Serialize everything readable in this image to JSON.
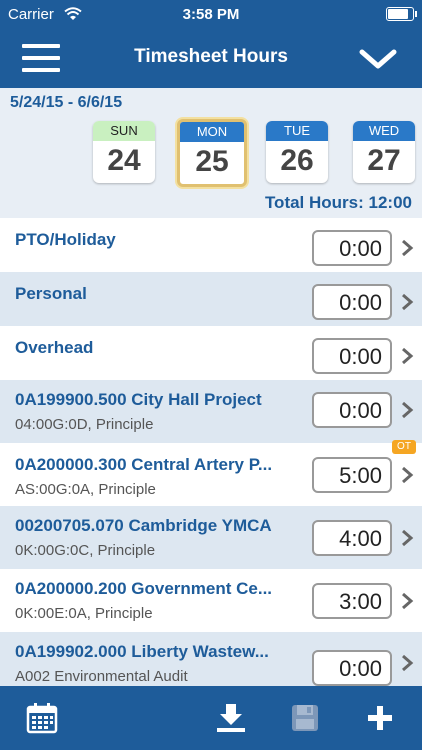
{
  "status_bar": {
    "carrier": "Carrier",
    "time": "3:58 PM",
    "battery_level": 0.9
  },
  "nav": {
    "title": "Timesheet Hours"
  },
  "week": {
    "range": "5/24/15 - 6/6/15",
    "days": [
      {
        "name": "SUN",
        "num": "24"
      },
      {
        "name": "MON",
        "num": "25"
      },
      {
        "name": "TUE",
        "num": "26"
      },
      {
        "name": "WED",
        "num": "27"
      }
    ],
    "selected_day": "MON",
    "total": "Total Hours: 12:00"
  },
  "rows": [
    {
      "label": "PTO/Holiday",
      "sub": "",
      "hours": "0:00",
      "badge": ""
    },
    {
      "label": "Personal",
      "sub": "",
      "hours": "0:00",
      "badge": ""
    },
    {
      "label": "Overhead",
      "sub": "",
      "hours": "0:00",
      "badge": ""
    },
    {
      "label": "0A199900.500 City Hall Project",
      "sub": "04:00G:0D, Principle",
      "hours": "0:00",
      "badge": ""
    },
    {
      "label": "0A200000.300 Central Artery P...",
      "sub": "AS:00G:0A, Principle",
      "hours": "5:00",
      "badge": "OT"
    },
    {
      "label": "00200705.070 Cambridge YMCA",
      "sub": "0K:00G:0C, Principle",
      "hours": "4:00",
      "badge": ""
    },
    {
      "label": "0A200000.200 Government Ce...",
      "sub": "0K:00E:0A, Principle",
      "hours": "3:00",
      "badge": ""
    },
    {
      "label": "0A199902.000 Liberty Wastew...",
      "sub": "A002 Environmental Audit",
      "hours": "0:00",
      "badge": ""
    }
  ],
  "colors": {
    "brand": "#1e5c9a",
    "row_alt": "#dde7f1",
    "ot_badge": "#f5a623"
  },
  "icons": [
    "menu-icon",
    "chevron-down-icon",
    "calendar-icon",
    "download-icon",
    "save-icon",
    "plus-icon"
  ]
}
